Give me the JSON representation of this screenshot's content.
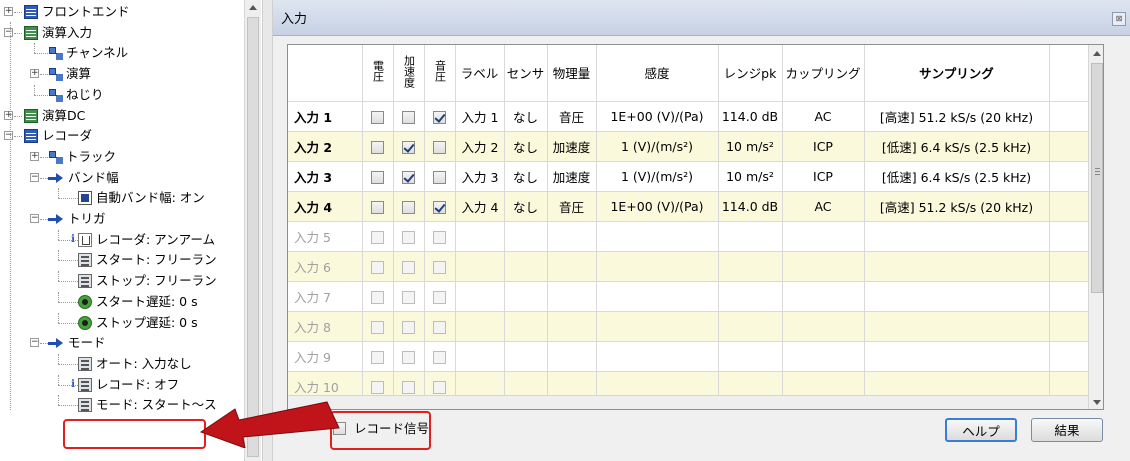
{
  "tree": {
    "items": [
      {
        "label": "フロントエンド",
        "icon": "blue-grid"
      },
      {
        "label": "演算入力",
        "icon": "green-grid"
      },
      {
        "label": "チャンネル",
        "icon": "tree-node"
      },
      {
        "label": "演算",
        "icon": "tree-node"
      },
      {
        "label": "ねじり",
        "icon": "tree-node"
      },
      {
        "label": "演算DC",
        "icon": "green-grid"
      },
      {
        "label": "レコーダ",
        "icon": "blue-grid"
      },
      {
        "label": "トラック",
        "icon": "tree-node"
      },
      {
        "label": "バンド幅",
        "icon": "arrow"
      },
      {
        "label": "自動バンド幅: オン",
        "icon": "square-blue"
      },
      {
        "label": "トリガ",
        "icon": "arrow"
      },
      {
        "label": "レコーダ: アンアーム",
        "icon": "trigger-glyph"
      },
      {
        "label": "スタート: フリーラン",
        "icon": "setting"
      },
      {
        "label": "ストップ: フリーラン",
        "icon": "setting"
      },
      {
        "label": "スタート遅延: 0 s",
        "icon": "green-circle"
      },
      {
        "label": "ストップ遅延: 0 s",
        "icon": "green-circle"
      },
      {
        "label": "モード",
        "icon": "arrow"
      },
      {
        "label": "オート: 入力なし",
        "icon": "setting"
      },
      {
        "label": "レコード: オフ",
        "icon": "setting"
      },
      {
        "label": "モード: スタート～ス",
        "icon": "setting"
      }
    ]
  },
  "panel": {
    "title": "入力",
    "close_glyph": "⊠"
  },
  "table": {
    "headers": {
      "c1": "電圧",
      "c2": "加速度",
      "c3": "音圧",
      "label": "ラベル",
      "sensor": "センサ",
      "quantity": "物理量",
      "sensitivity": "感度",
      "range": "レンジpk",
      "coupling": "カップリング",
      "sampling": "サンプリング"
    },
    "rows": [
      {
        "name": "入力 1",
        "cb": [
          false,
          false,
          true
        ],
        "label": "入力 1",
        "sensor": "なし",
        "quantity": "音圧",
        "sensitivity": "1E+00 (V)/(Pa)",
        "range": "114.0 dB",
        "coupling": "AC",
        "sampling": "[高速] 51.2 kS/s (20 kHz)"
      },
      {
        "name": "入力 2",
        "cb": [
          false,
          true,
          false
        ],
        "label": "入力 2",
        "sensor": "なし",
        "quantity": "加速度",
        "sensitivity": "1 (V)/(m/s²)",
        "range": "10 m/s²",
        "coupling": "ICP",
        "sampling": "[低速] 6.4 kS/s (2.5 kHz)"
      },
      {
        "name": "入力 3",
        "cb": [
          false,
          true,
          false
        ],
        "label": "入力 3",
        "sensor": "なし",
        "quantity": "加速度",
        "sensitivity": "1 (V)/(m/s²)",
        "range": "10 m/s²",
        "coupling": "ICP",
        "sampling": "[低速] 6.4 kS/s (2.5 kHz)"
      },
      {
        "name": "入力 4",
        "cb": [
          false,
          false,
          true
        ],
        "label": "入力 4",
        "sensor": "なし",
        "quantity": "音圧",
        "sensitivity": "1E+00 (V)/(Pa)",
        "range": "114.0 dB",
        "coupling": "AC",
        "sampling": "[高速] 51.2 kS/s (20 kHz)"
      },
      {
        "name": "入力 5",
        "cb": [
          false,
          false,
          false
        ],
        "label": "",
        "sensor": "",
        "quantity": "",
        "sensitivity": "",
        "range": "",
        "coupling": "",
        "sampling": ""
      },
      {
        "name": "入力 6",
        "cb": [
          false,
          false,
          false
        ],
        "label": "",
        "sensor": "",
        "quantity": "",
        "sensitivity": "",
        "range": "",
        "coupling": "",
        "sampling": ""
      },
      {
        "name": "入力 7",
        "cb": [
          false,
          false,
          false
        ],
        "label": "",
        "sensor": "",
        "quantity": "",
        "sensitivity": "",
        "range": "",
        "coupling": "",
        "sampling": ""
      },
      {
        "name": "入力 8",
        "cb": [
          false,
          false,
          false
        ],
        "label": "",
        "sensor": "",
        "quantity": "",
        "sensitivity": "",
        "range": "",
        "coupling": "",
        "sampling": ""
      },
      {
        "name": "入力 9",
        "cb": [
          false,
          false,
          false
        ],
        "label": "",
        "sensor": "",
        "quantity": "",
        "sensitivity": "",
        "range": "",
        "coupling": "",
        "sampling": ""
      },
      {
        "name": "入力 10",
        "cb": [
          false,
          false,
          false
        ],
        "label": "",
        "sensor": "",
        "quantity": "",
        "sensitivity": "",
        "range": "",
        "coupling": "",
        "sampling": ""
      }
    ]
  },
  "footer": {
    "record_signal_label": "レコード信号",
    "record_signal_checked": false,
    "help_label": "ヘルプ",
    "result_label": "結果"
  },
  "annotation": {
    "color": "#e02020"
  }
}
